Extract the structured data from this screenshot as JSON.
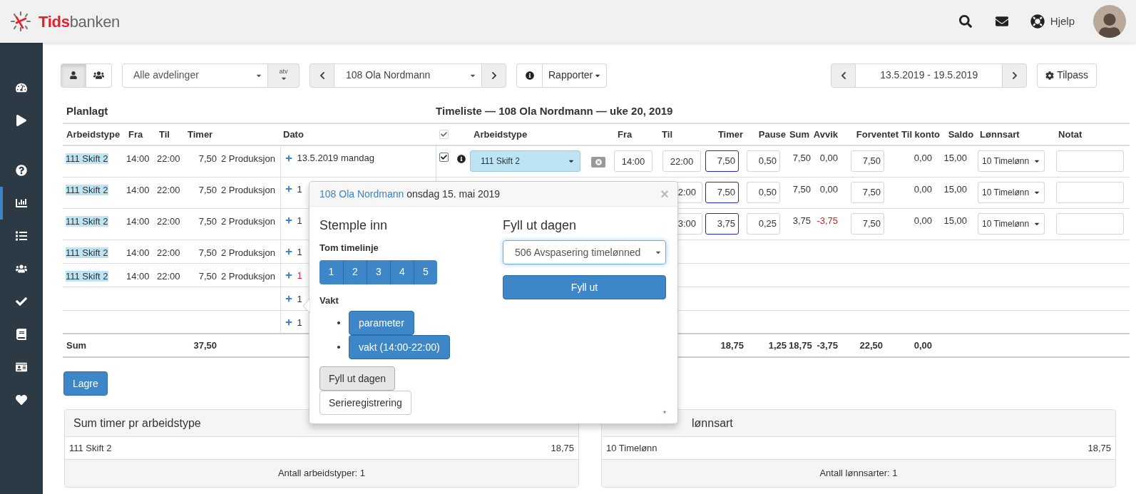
{
  "header": {
    "logo": {
      "part_1": "Tids",
      "part_2": "banken"
    },
    "help": "Hjelp"
  },
  "sidebar": {
    "items": [
      {
        "selected": false
      },
      {
        "selected": false
      },
      {
        "selected": false
      },
      {
        "selected": true
      },
      {
        "selected": false
      },
      {
        "selected": false
      },
      {
        "selected": false
      },
      {
        "selected": false
      },
      {
        "selected": false
      },
      {
        "selected": false
      }
    ]
  },
  "toolbar": {
    "view_toggle": [
      {
        "selected": true
      },
      {
        "selected": false
      }
    ],
    "department": "Alle avdelinger",
    "atv": "atv",
    "employee": "108 Ola Nordmann",
    "reports": "Rapporter",
    "date_range": "13.5.2019 - 19.5.2019",
    "customize": "Tilpass"
  },
  "planned": {
    "title": "Planlagt",
    "columns": [
      "Arbeidstype",
      "Fra",
      "Til",
      "Timer"
    ],
    "date_column": "Dato",
    "sum_label": "Sum",
    "sum_timer": "37,50"
  },
  "timesheet": {
    "title": "Timeliste — 108 Ola Nordmann — uke 20, 2019",
    "select_all_checked": true,
    "columns": [
      "Arbeidstype",
      "Fra",
      "Til",
      "Timer",
      "Pause",
      "Sum",
      "Avvik",
      "Forventet",
      "Til konto",
      "Saldo",
      "Lønnsart",
      "Notat"
    ],
    "sums": {
      "timer": "18,75",
      "pause": "1,25",
      "sum": "18,75",
      "avvik": "-3,75",
      "forventet": "22,50",
      "til_konto": "0,00"
    }
  },
  "rows": [
    {
      "planned": {
        "arbeidstype": "111 Skift 2",
        "fra": "14:00",
        "til": "22:00",
        "timer": "7,50",
        "column_5": "2 Produksjon"
      },
      "date": {
        "text": "13.5.2019 mandag",
        "holiday": false
      },
      "timesheet": {
        "checked": true,
        "arbeidstype": "111 Skift 2",
        "fra": "14:00",
        "til": "22:00",
        "timer": "7,50",
        "pause": "0,50",
        "sum": "7,50",
        "avvik": "0,00",
        "avvik_negative": false,
        "forventet": "7,50",
        "til_konto": "0,00",
        "saldo": "15,00",
        "lonnsart": "10 Timelønn"
      }
    },
    {
      "planned": {
        "arbeidstype": "111 Skift 2",
        "fra": "14:00",
        "til": "22:00",
        "timer": "7,50",
        "column_5": "2 Produksjon"
      },
      "date": {
        "text": "1",
        "holiday": false
      },
      "timesheet": {
        "til": "2:00",
        "timer": "7,50",
        "pause": "0,50",
        "sum": "7,50",
        "avvik": "0,00",
        "avvik_negative": false,
        "forventet": "7,50",
        "til_konto": "0,00",
        "saldo": "15,00",
        "lonnsart": "10 Timelønn"
      }
    },
    {
      "planned": {
        "arbeidstype": "111 Skift 2",
        "fra": "14:00",
        "til": "22:00",
        "timer": "7,50",
        "column_5": "2 Produksjon"
      },
      "date": {
        "text": "1",
        "holiday": false
      },
      "timesheet": {
        "til": "3:00",
        "timer": "3,75",
        "pause": "0,25",
        "sum": "3,75",
        "avvik": "-3,75",
        "avvik_negative": true,
        "forventet": "7,50",
        "til_konto": "0,00",
        "saldo": "15,00",
        "lonnsart": "10 Timelønn"
      }
    },
    {
      "planned": {
        "arbeidstype": "111 Skift 2",
        "fra": "14:00",
        "til": "22:00",
        "timer": "7,50",
        "column_5": "2 Produksjon"
      },
      "date": {
        "text": "1",
        "holiday": false
      }
    },
    {
      "planned": {
        "arbeidstype": "111 Skift 2",
        "fra": "14:00",
        "til": "22:00",
        "timer": "7,50",
        "column_5": "2 Produksjon"
      },
      "date": {
        "text": "1",
        "holiday": true
      }
    },
    {
      "date": {
        "text": "1",
        "holiday": false
      }
    },
    {
      "date": {
        "text": "1",
        "holiday": false
      }
    }
  ],
  "save": "Lagre",
  "panels": [
    {
      "title": "Sum timer pr arbeidstype",
      "rows": [
        {
          "label": "111 Skift 2",
          "value": "18,75"
        }
      ],
      "footer": "Antall arbeidstyper: 1"
    },
    {
      "title": "lønnsart",
      "rows": [
        {
          "label": "10 Timelønn",
          "value": "18,75"
        }
      ],
      "footer": "Antall lønnsarter: 1"
    }
  ],
  "popover": {
    "employee": "108 Ola Nordmann",
    "date": "onsdag 15. mai 2019",
    "close": "×",
    "left": {
      "title": "Stemple inn",
      "empty_label": "Tom timelinje",
      "numbers": [
        "1",
        "2",
        "3",
        "4",
        "5"
      ],
      "shift_label": "Vakt",
      "shifts": [
        "parameter",
        "vakt (14:00-22:00)"
      ],
      "fill_day": "Fyll ut dagen",
      "series": "Serieregistrering"
    },
    "right": {
      "title": "Fyll ut dagen",
      "select": "506 Avspasering timelønned",
      "button": "Fyll ut"
    },
    "footnote": "*"
  }
}
